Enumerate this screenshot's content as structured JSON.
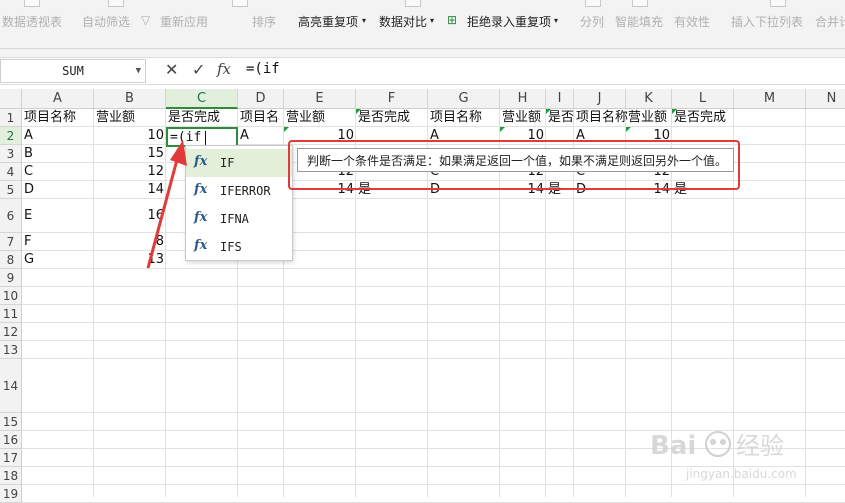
{
  "ribbon": {
    "items": [
      {
        "label": "数据透视表",
        "active": false
      },
      {
        "label": "自动筛选",
        "active": false
      },
      {
        "label": "重新应用",
        "active": false
      },
      {
        "label": "排序",
        "active": false
      },
      {
        "label": "高亮重复项",
        "active": true
      },
      {
        "label": "数据对比",
        "active": true
      },
      {
        "label": "拒绝录入重复项",
        "active": true
      },
      {
        "label": "分列",
        "active": false
      },
      {
        "label": "智能填充",
        "active": false
      },
      {
        "label": "有效性",
        "active": false
      },
      {
        "label": "插入下拉列表",
        "active": false
      },
      {
        "label": "合并计",
        "active": false
      }
    ]
  },
  "formula_bar": {
    "name_box": "SUM",
    "cancel_icon": "✕",
    "confirm_icon": "✓",
    "fx_label": "fx",
    "formula": "=(if"
  },
  "columns": [
    "A",
    "B",
    "C",
    "D",
    "E",
    "F",
    "G",
    "H",
    "I",
    "J",
    "K",
    "L",
    "M",
    "N"
  ],
  "selected_column": "C",
  "rows": [
    "1",
    "2",
    "3",
    "4",
    "5",
    "6",
    "7",
    "8",
    "9",
    "10",
    "11",
    "12",
    "13",
    "14",
    "15",
    "16",
    "17",
    "18",
    "19"
  ],
  "selected_row": "2",
  "header_row": {
    "A": "项目名称",
    "B": "营业额",
    "C": "是否完成",
    "D": "项目名",
    "E": "营业额",
    "F": "是否完成",
    "G": "项目名称",
    "H": "营业额",
    "I": "是否",
    "J": "项目名称",
    "K": "营业额",
    "L": "是否完成"
  },
  "table_rows": [
    {
      "A": "A",
      "B": "10",
      "D": "A",
      "E": "10",
      "G": "A",
      "H": "10",
      "J": "A",
      "K": "10"
    },
    {
      "A": "B",
      "B": "15"
    },
    {
      "A": "C",
      "B": "12",
      "E": "12",
      "G": "C",
      "H": "12",
      "J": "C",
      "K": "12"
    },
    {
      "A": "D",
      "B": "14",
      "E": "14",
      "F": "是",
      "G": "D",
      "H": "14",
      "I": "是",
      "J": "D",
      "K": "14",
      "L": "是"
    },
    {
      "A": "E",
      "B": "16"
    },
    {
      "A": "F",
      "B": "8"
    },
    {
      "A": "G",
      "B": "13"
    }
  ],
  "active_cell": {
    "ref": "C2",
    "text": "=(if"
  },
  "autocomplete": {
    "fx_icon": "fx",
    "items": [
      "IF",
      "IFERROR",
      "IFNA",
      "IFS"
    ],
    "highlighted": 0
  },
  "tooltip": "判断一个条件是否满足：如果满足返回一个值，如果不满足则返回另外一个值。",
  "colors": {
    "accent_green": "#2e8b3e",
    "annotation_red": "#e03a3a"
  }
}
